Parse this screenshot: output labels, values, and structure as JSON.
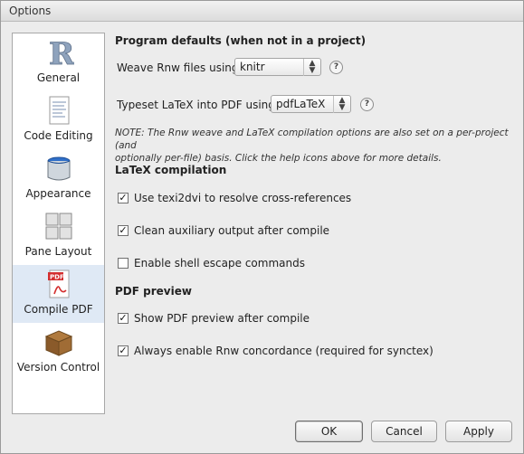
{
  "window": {
    "title": "Options"
  },
  "sidebar": {
    "items": [
      {
        "label": "General",
        "icon": "r-logo-icon",
        "selected": false
      },
      {
        "label": "Code Editing",
        "icon": "document-icon",
        "selected": false
      },
      {
        "label": "Appearance",
        "icon": "paint-bucket-icon",
        "selected": false
      },
      {
        "label": "Pane Layout",
        "icon": "pane-grid-icon",
        "selected": false
      },
      {
        "label": "Compile PDF",
        "icon": "pdf-icon",
        "selected": true
      },
      {
        "label": "Version Control",
        "icon": "box-icon",
        "selected": false
      }
    ]
  },
  "program_defaults": {
    "title": "Program defaults (when not in a project)",
    "weave_label": "Weave Rnw files using:",
    "weave_value": "knitr",
    "typeset_label": "Typeset LaTeX into PDF using:",
    "typeset_value": "pdfLaTeX",
    "help_glyph": "?",
    "note_line1": "NOTE: The Rnw weave and LaTeX compilation options are also set on a per-project (and",
    "note_line2": "optionally per-file) basis. Click the help icons above for more details."
  },
  "latex_compilation": {
    "title": "LaTeX compilation",
    "options": [
      {
        "label": "Use texi2dvi to resolve cross-references",
        "checked": true
      },
      {
        "label": "Clean auxiliary output after compile",
        "checked": true
      },
      {
        "label": "Enable shell escape commands",
        "checked": false
      }
    ]
  },
  "pdf_preview": {
    "title": "PDF preview",
    "options": [
      {
        "label": "Show PDF preview after compile",
        "checked": true
      },
      {
        "label": "Always enable Rnw concordance (required for synctex)",
        "checked": true
      }
    ]
  },
  "buttons": {
    "ok": "OK",
    "cancel": "Cancel",
    "apply": "Apply"
  },
  "colors": {
    "selection": "#dfe9f5",
    "pdf_red": "#d32f2f"
  }
}
